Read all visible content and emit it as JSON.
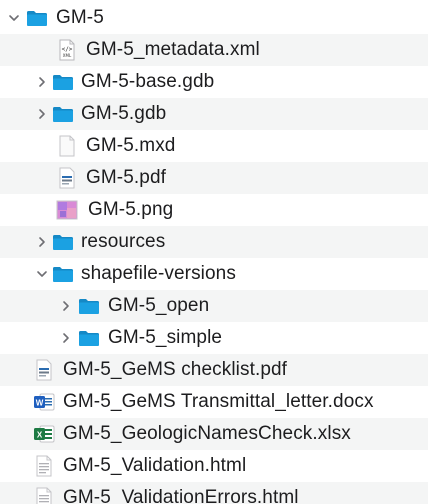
{
  "tree": {
    "items": [
      {
        "label": "GM-5",
        "kind": "folder",
        "expanded": true,
        "icon": "folder-icon"
      },
      {
        "label": "GM-5_metadata.xml",
        "kind": "file",
        "icon": "xml-file-icon"
      },
      {
        "label": "GM-5-base.gdb",
        "kind": "folder",
        "expanded": false,
        "icon": "folder-icon"
      },
      {
        "label": "GM-5.gdb",
        "kind": "folder",
        "expanded": false,
        "icon": "folder-icon"
      },
      {
        "label": "GM-5.mxd",
        "kind": "file",
        "icon": "blank-file-icon"
      },
      {
        "label": "GM-5.pdf",
        "kind": "file",
        "icon": "pdf-file-icon"
      },
      {
        "label": "GM-5.png",
        "kind": "file",
        "icon": "png-image-icon"
      },
      {
        "label": "resources",
        "kind": "folder",
        "expanded": false,
        "icon": "folder-icon"
      },
      {
        "label": "shapefile-versions",
        "kind": "folder",
        "expanded": true,
        "icon": "folder-icon"
      },
      {
        "label": "GM-5_open",
        "kind": "folder",
        "expanded": false,
        "icon": "folder-icon"
      },
      {
        "label": "GM-5_simple",
        "kind": "folder",
        "expanded": false,
        "icon": "folder-icon"
      },
      {
        "label": "GM-5_GeMS checklist.pdf",
        "kind": "file",
        "icon": "pdf-file-icon"
      },
      {
        "label": "GM-5_GeMS Transmittal_letter.docx",
        "kind": "file",
        "icon": "word-doc-icon"
      },
      {
        "label": "GM-5_GeologicNamesCheck.xlsx",
        "kind": "file",
        "icon": "excel-sheet-icon"
      },
      {
        "label": "GM-5_Validation.html",
        "kind": "file",
        "icon": "html-file-icon"
      },
      {
        "label": "GM-5_ValidationErrors.html",
        "kind": "file",
        "icon": "html-file-icon"
      }
    ]
  },
  "colors": {
    "folder": "#1ba1e2",
    "folder_dark": "#1589c6",
    "alt_row": "#f4f5f5",
    "text": "#1d1d1f",
    "chevron": "#6e6e73"
  }
}
